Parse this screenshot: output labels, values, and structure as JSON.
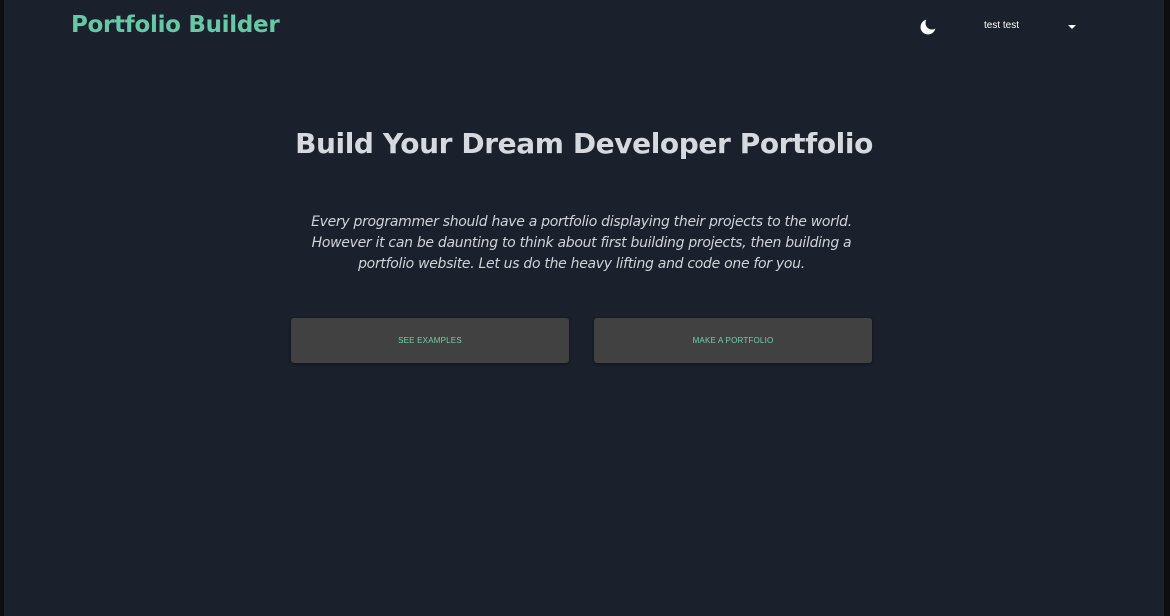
{
  "header": {
    "brand": "Portfolio Builder",
    "theme_toggle_icon": "moon-icon",
    "user_menu": {
      "name": "test test",
      "caret_icon": "caret-down-icon"
    }
  },
  "hero": {
    "title": "Build Your Dream Developer Portfolio",
    "description": "Every programmer should have a portfolio displaying their projects to the world. However it can be daunting to think about first building projects, then building a portfolio website. Let us do the heavy lifting and code one for you."
  },
  "actions": {
    "see_examples": "SEE EXAMPLES",
    "make_portfolio": "MAKE A PORTFOLIO"
  },
  "colors": {
    "background": "#1a202c",
    "accent": "#68c7a4",
    "button_bg": "#414141",
    "text": "#d6d9df"
  }
}
